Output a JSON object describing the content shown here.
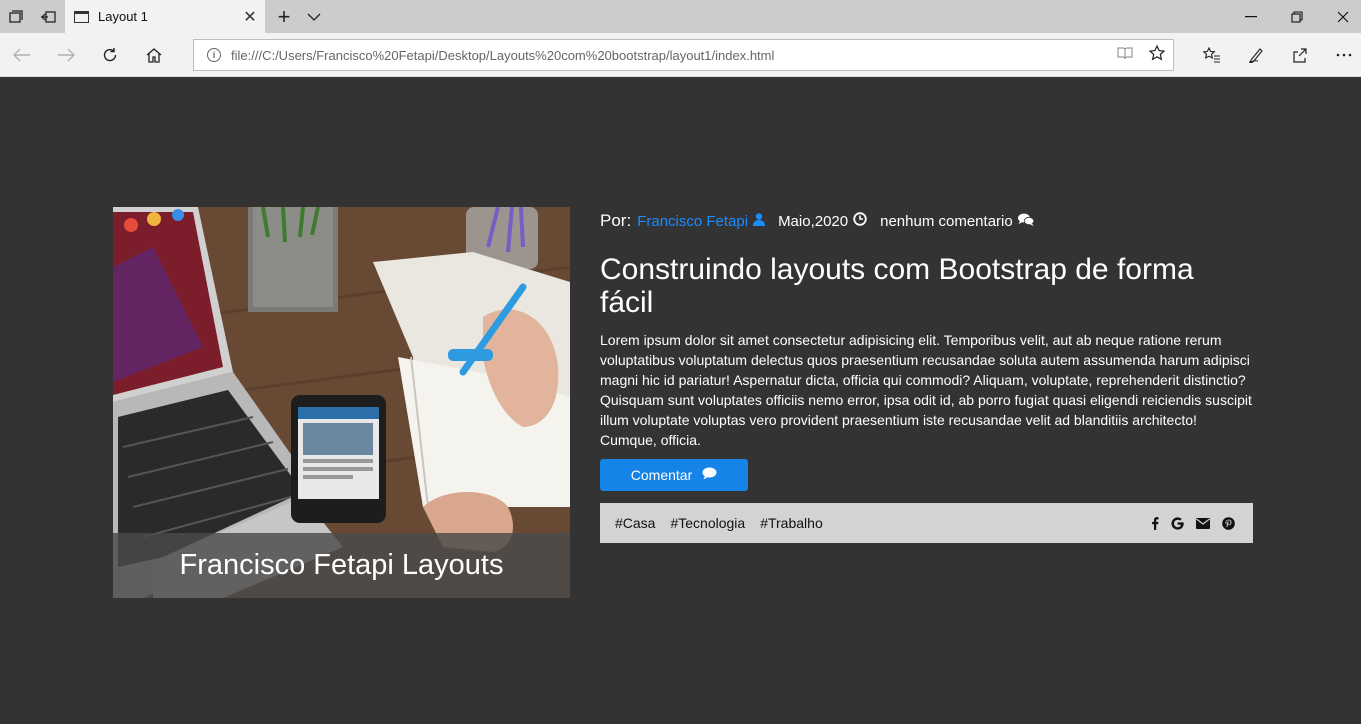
{
  "browser": {
    "tab_title": "Layout 1",
    "url": "file:///C:/Users/Francisco%20Fetapi/Desktop/Layouts%20com%20bootstrap/layout1/index.html"
  },
  "hero": {
    "caption": "Francisco Fetapi Layouts"
  },
  "post": {
    "by_label": "Por:",
    "author": "Francisco Fetapi",
    "date": "Maio,2020",
    "comments": "nenhum comentario",
    "title": "Construindo layouts com Bootstrap de forma fácil",
    "body": "Lorem ipsum dolor sit amet consectetur adipisicing elit. Temporibus velit, aut ab neque ratione rerum voluptatibus voluptatum delectus quos praesentium recusandae soluta autem assumenda harum adipisci magni hic id pariatur! Aspernatur dicta, officia qui commodi? Aliquam, voluptate, reprehenderit distinctio? Quisquam sunt voluptates officiis nemo error, ipsa odit id, ab porro fugiat quasi eligendi reiciendis suscipit illum voluptate voluptas vero provident praesentium iste recusandae velit ad blanditiis architecto! Cumque, officia.",
    "comment_button": "Comentar",
    "tags": [
      "#Casa",
      "#Tecnologia",
      "#Trabalho"
    ],
    "social_icons": [
      "facebook-icon",
      "google-icon",
      "envelope-icon",
      "pinterest-icon"
    ]
  },
  "colors": {
    "page_bg": "#333333",
    "accent": "#1583e8",
    "author_link": "#1a8cff",
    "tagbar_bg": "#d3d3d3"
  }
}
